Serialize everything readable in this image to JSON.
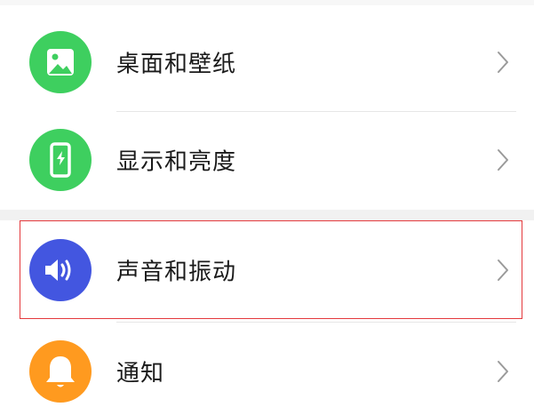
{
  "settings_list": {
    "items": [
      {
        "label": "桌面和壁纸",
        "icon": "wallpaper-icon",
        "icon_color": "#3ecf5f"
      },
      {
        "label": "显示和亮度",
        "icon": "phone-brightness-icon",
        "icon_color": "#3ecf5f"
      },
      {
        "label": "声音和振动",
        "icon": "speaker-icon",
        "icon_color": "#4356e0"
      },
      {
        "label": "通知",
        "icon": "bell-icon",
        "icon_color": "#ff9a1f"
      }
    ]
  },
  "annotation": {
    "highlight_color": "#e4393c"
  }
}
